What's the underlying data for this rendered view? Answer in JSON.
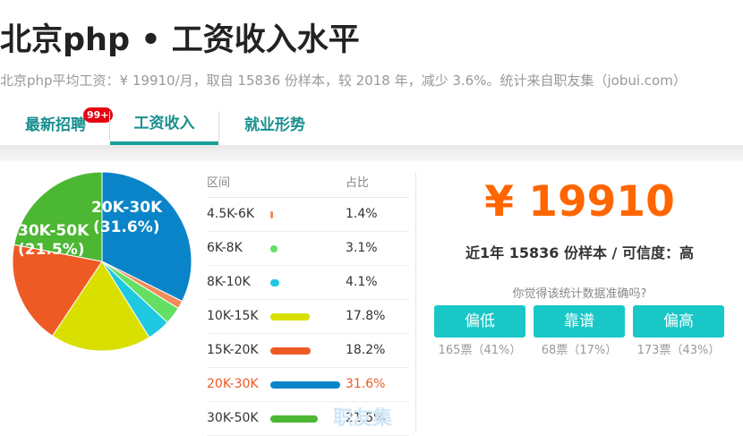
{
  "page": {
    "title": "北京php • 工资收入水平",
    "subtitle": "北京php平均工资：¥ 19910/月，取自 15836 份样本，较 2018 年，减少 3.6%。统计来自职友集（jobui.com）"
  },
  "tabs": [
    {
      "label": "最新招聘",
      "badge": "99+",
      "active": false
    },
    {
      "label": "工资收入",
      "active": true
    },
    {
      "label": "就业形势",
      "active": false
    }
  ],
  "table": {
    "headers": [
      "区间",
      "占比"
    ],
    "rows": [
      {
        "range": "4.5K-6K",
        "pct": "1.4%",
        "value": 1.4,
        "color": "#f28c5a"
      },
      {
        "range": "6K-8K",
        "pct": "3.1%",
        "value": 3.1,
        "color": "#63e063"
      },
      {
        "range": "8K-10K",
        "pct": "4.1%",
        "value": 4.1,
        "color": "#1ec8e0"
      },
      {
        "range": "10K-15K",
        "pct": "17.8%",
        "value": 17.8,
        "color": "#d9e000"
      },
      {
        "range": "15K-20K",
        "pct": "18.2%",
        "value": 18.2,
        "color": "#ee5a24"
      },
      {
        "range": "20K-30K",
        "pct": "31.6%",
        "value": 31.6,
        "color": "#0a84c8",
        "highlight": true
      },
      {
        "range": "30K-50K",
        "pct": "21.5%",
        "value": 21.5,
        "color": "#4bb732"
      }
    ]
  },
  "pie": {
    "label_a": "20K-30K",
    "label_a_pct": "(31.6%)",
    "label_b": "30K-50K",
    "label_b_pct": "(21.5%)"
  },
  "stats": {
    "salary": "¥ 19910",
    "sample": "近1年 15836 份样本 / 可信度：高",
    "question": "你觉得该统计数据准确吗?"
  },
  "votes": [
    {
      "label": "偏低",
      "count": "165票（41%）"
    },
    {
      "label": "靠谱",
      "count": "68票（17%）"
    },
    {
      "label": "偏高",
      "count": "173票（43%）"
    }
  ],
  "watermark": "职友集"
}
